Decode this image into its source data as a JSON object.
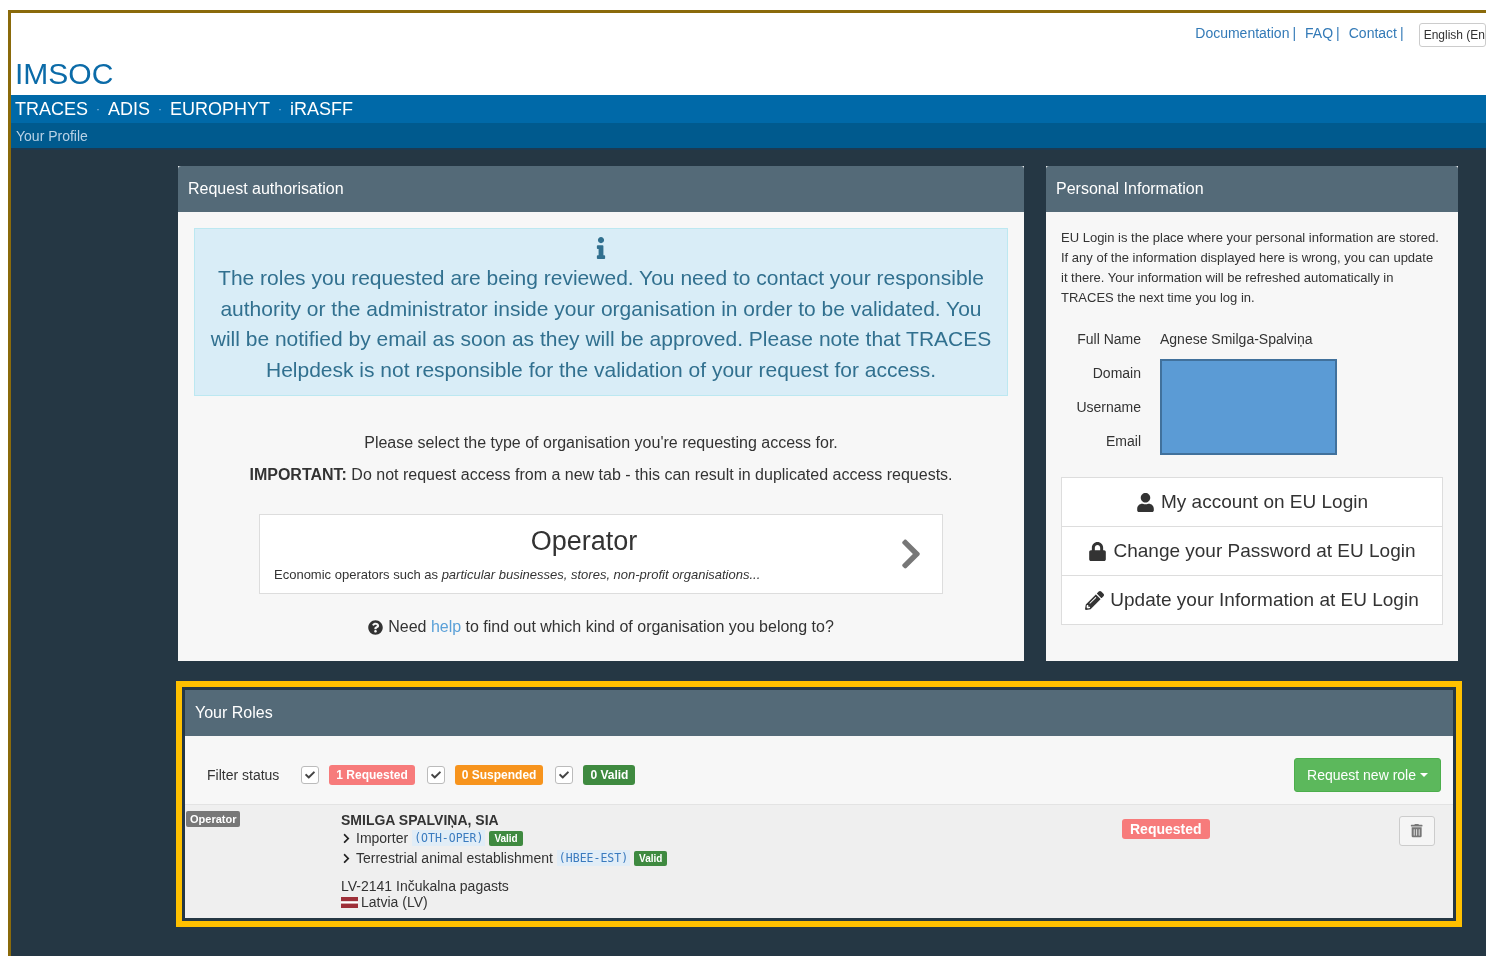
{
  "header": {
    "links": [
      "Documentation",
      "FAQ",
      "Contact"
    ],
    "separator": "|",
    "language": "English (En",
    "logo": "IMSOC"
  },
  "nav": {
    "items": [
      "TRACES",
      "ADIS",
      "EUROPHYT",
      "iRASFF"
    ],
    "separator": "·"
  },
  "breadcrumb": "Your Profile",
  "request_panel": {
    "title": "Request authorisation",
    "alert": "The roles you requested are being reviewed. You need to contact your responsible authority or the administrator inside your organisation in order to be validated. You will be notified by email as soon as they will be approved. Please note that TRACES Helpdesk is not responsible for the validation of your request for access.",
    "intro": "Please select the type of organisation you're requesting access for.",
    "important": "**IMPORTANT:** Do not request access from a new tab - this can result in duplicated access requests.",
    "card": {
      "title": "Operator",
      "description": "Economic operators such as *particular businesses, stores, non-profit organisations...*"
    },
    "help": {
      "before": "Need",
      "link": "help",
      "after": "to find out which kind of organisation you belong to?"
    }
  },
  "personal_panel": {
    "title": "Personal Information",
    "text": "EU Login is the place where your personal information are stored. If any of the information displayed here is wrong, you can update it there. Your information will be refreshed automatically in TRACES the next time you log in.",
    "fields": [
      {
        "label": "Full Name",
        "value": "Agnese Smilga-Spalviņa"
      },
      {
        "label": "Domain"
      },
      {
        "label": "Username"
      },
      {
        "label": "Email"
      }
    ],
    "buttons": [
      {
        "kind": "user",
        "label": "My account on EU Login"
      },
      {
        "kind": "lock",
        "label": "Change your Password at EU Login"
      },
      {
        "kind": "edit",
        "label": "Update your Information at EU Login"
      }
    ]
  },
  "roles": {
    "title": "Your Roles",
    "filter_label": "Filter status",
    "filters": [
      {
        "label": "1 Requested",
        "checked": true,
        "color": "#f77b7b"
      },
      {
        "label": "0 Suspended",
        "checked": true,
        "color": "#f7941d"
      },
      {
        "label": "0 Valid",
        "checked": true,
        "color": "#3f8a40"
      }
    ],
    "new_role_button": "Request new role",
    "rows": [
      {
        "type": "Operator",
        "name": "SMILGA SPALVIŅA, SIA",
        "activities": [
          {
            "name": "Importer",
            "code": "(OTH-OPER)",
            "status": "Valid"
          },
          {
            "name": "Terrestrial animal establishment",
            "code": "(HBEE-EST)",
            "status": "Valid"
          }
        ],
        "address": "LV-2141 Inčukalna pagasts",
        "country": "Latvia (LV)",
        "status": "Requested"
      }
    ]
  }
}
